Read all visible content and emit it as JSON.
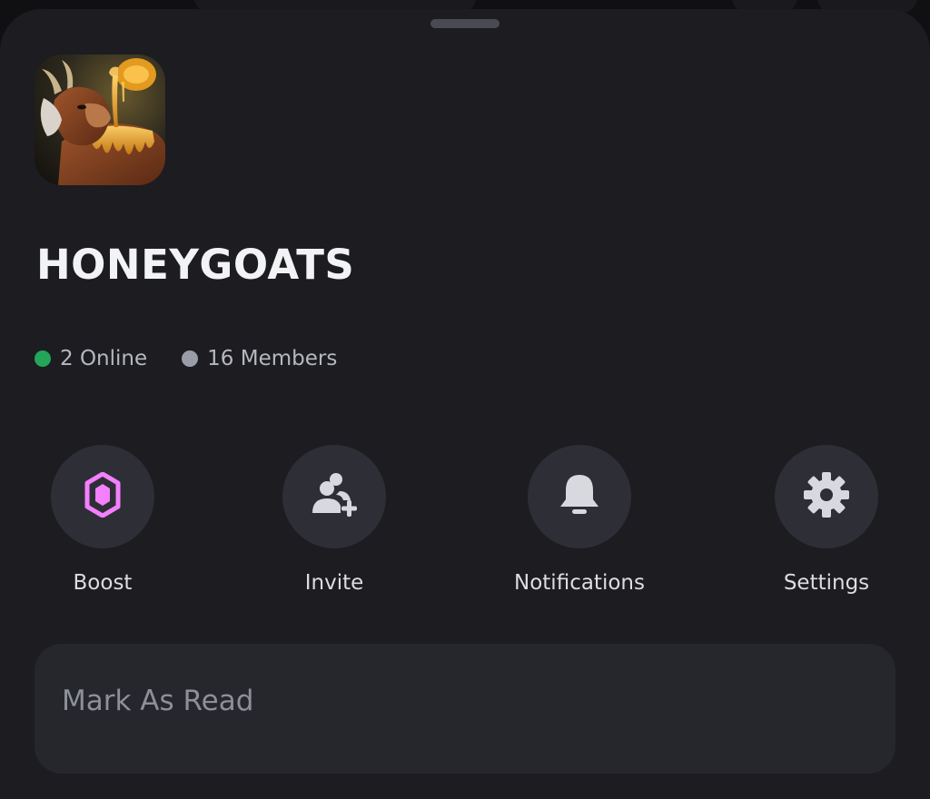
{
  "server": {
    "name": "HONEYGOATS",
    "icon": "goat-pouring-honey-avatar"
  },
  "stats": {
    "online": "2 Online",
    "members": "16 Members",
    "online_color": "#23a55a",
    "members_color": "#9a9ca8"
  },
  "actions": [
    {
      "label": "Boost",
      "icon": "boost-gem-icon",
      "color": "#f47fff"
    },
    {
      "label": "Invite",
      "icon": "invite-person-add-icon",
      "color": "#d8d9de"
    },
    {
      "label": "Notifications",
      "icon": "bell-icon",
      "color": "#d8d9de"
    },
    {
      "label": "Settings",
      "icon": "gear-icon",
      "color": "#d8d9de"
    }
  ],
  "mark_as_read": {
    "label": "Mark As Read"
  },
  "theme": {
    "sheet_bg": "#1c1c21",
    "button_bg": "#2e2f36",
    "text_primary": "#f2f3f5"
  }
}
